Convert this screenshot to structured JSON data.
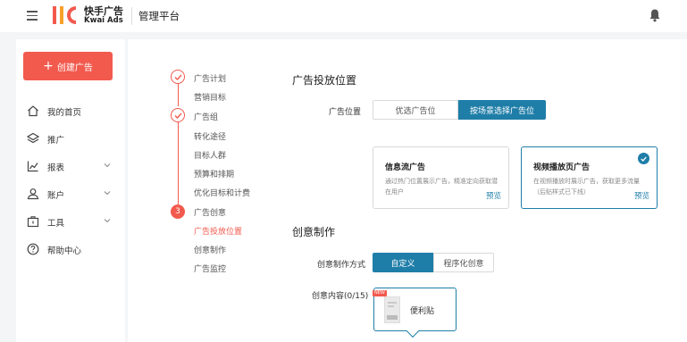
{
  "header": {
    "brand_cn": "快手广告",
    "brand_en": "Kwai Ads",
    "platform": "管理平台",
    "bell_icon": "bell-icon",
    "menu_icon": "hamburger-menu-icon"
  },
  "sidebar": {
    "create_button": "创建广告",
    "items": [
      {
        "label": "我的首页",
        "icon": "home-icon",
        "has_chevron": false
      },
      {
        "label": "推广",
        "icon": "layers-icon",
        "has_chevron": false
      },
      {
        "label": "报表",
        "icon": "chart-icon",
        "has_chevron": true
      },
      {
        "label": "账户",
        "icon": "user-icon",
        "has_chevron": true
      },
      {
        "label": "工具",
        "icon": "toolbox-icon",
        "has_chevron": true
      },
      {
        "label": "帮助中心",
        "icon": "help-icon",
        "has_chevron": false
      }
    ]
  },
  "steps": {
    "plan": "广告计划",
    "plan_sub": [
      "营销目标"
    ],
    "group": "广告组",
    "group_sub": [
      "转化途径",
      "目标人群",
      "预算和排期",
      "优化目标和计费"
    ],
    "creative_num": "3",
    "creative": "广告创意",
    "creative_sub": [
      "广告投放位置",
      "创意制作",
      "广告监控"
    ]
  },
  "placement": {
    "title": "广告投放位置",
    "label": "广告位置",
    "options": [
      "优选广告位",
      "按场景选择广告位"
    ],
    "active_index": 1,
    "cards": [
      {
        "title": "信息流广告",
        "desc": "通过热门位置展示广告，精准定向获取潜在用户",
        "link": "预览",
        "selected": false
      },
      {
        "title": "视频播放页广告",
        "desc": "在视频播放时展示广告，获取更多流量（后贴样式已下线）",
        "link": "预览",
        "selected": true
      }
    ]
  },
  "creative": {
    "title": "创意制作",
    "method_label": "创意制作方式",
    "methods": [
      "自定义",
      "程序化创意"
    ],
    "active_index": 0,
    "content_label": "创意内容(0/15)",
    "new_badge": "NEW",
    "content_item": "便利贴"
  },
  "colors": {
    "accent_red": "#f25a4e",
    "accent_blue": "#1f7ea8"
  }
}
